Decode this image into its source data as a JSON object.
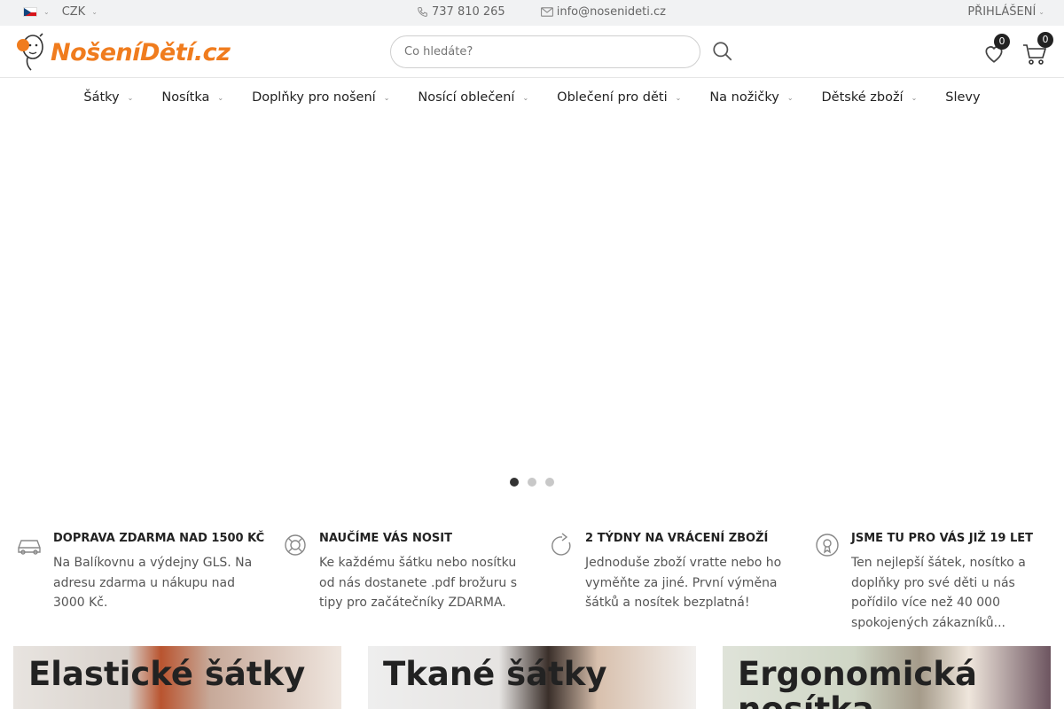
{
  "topbar": {
    "currency": "CZK",
    "phone": "737 810 265",
    "email": "info@nosenideti.cz",
    "login": "PŘIHLÁŠENÍ"
  },
  "header": {
    "logo_text": "NošeníDětí.cz",
    "search_placeholder": "Co hledáte?",
    "wishlist_count": "0",
    "cart_count": "0"
  },
  "nav": {
    "items": [
      {
        "label": "Šátky"
      },
      {
        "label": "Nosítka"
      },
      {
        "label": "Doplňky pro nošení"
      },
      {
        "label": "Nosící oblečení"
      },
      {
        "label": "Oblečení pro děti"
      },
      {
        "label": "Na nožičky"
      },
      {
        "label": "Dětské zboží"
      },
      {
        "label": "Slevy"
      }
    ]
  },
  "slider": {
    "dot_count": 3,
    "active_index": 0
  },
  "benefits": [
    {
      "title": "DOPRAVA ZDARMA NAD 1500 KČ",
      "text": "Na Balíkovnu a výdejny GLS. Na adresu zdarma u nákupu nad 3000 Kč.",
      "icon": "car-icon"
    },
    {
      "title": "NAUČÍME VÁS NOSIT",
      "text": "Ke každému šátku nebo nosítku od nás dostanete .pdf brožuru s tipy pro začátečníky ZDARMA.",
      "icon": "lifebuoy-icon"
    },
    {
      "title": "2 TÝDNY NA VRÁCENÍ ZBOŽÍ",
      "text": "Jednoduše zboží vratte nebo ho vyměňte za jiné. První výměna šátků a nosítek bezplatná!",
      "icon": "return-icon"
    },
    {
      "title": "JSME TU PRO VÁS JIŽ 19 LET",
      "text": "Ten nejlepší šátek, nosítko a doplňky pro své děti u nás pořídilo více než 40 000 spokojených zákazníků...",
      "icon": "badge-icon"
    }
  ],
  "banners": [
    {
      "title": "Elastické šátky"
    },
    {
      "title": "Tkané šátky"
    },
    {
      "title": "Ergonomická nosítka"
    }
  ],
  "colors": {
    "brand_orange": "#f07c1e",
    "topbar_bg": "#f1f2f3",
    "text_dark": "#222222"
  }
}
